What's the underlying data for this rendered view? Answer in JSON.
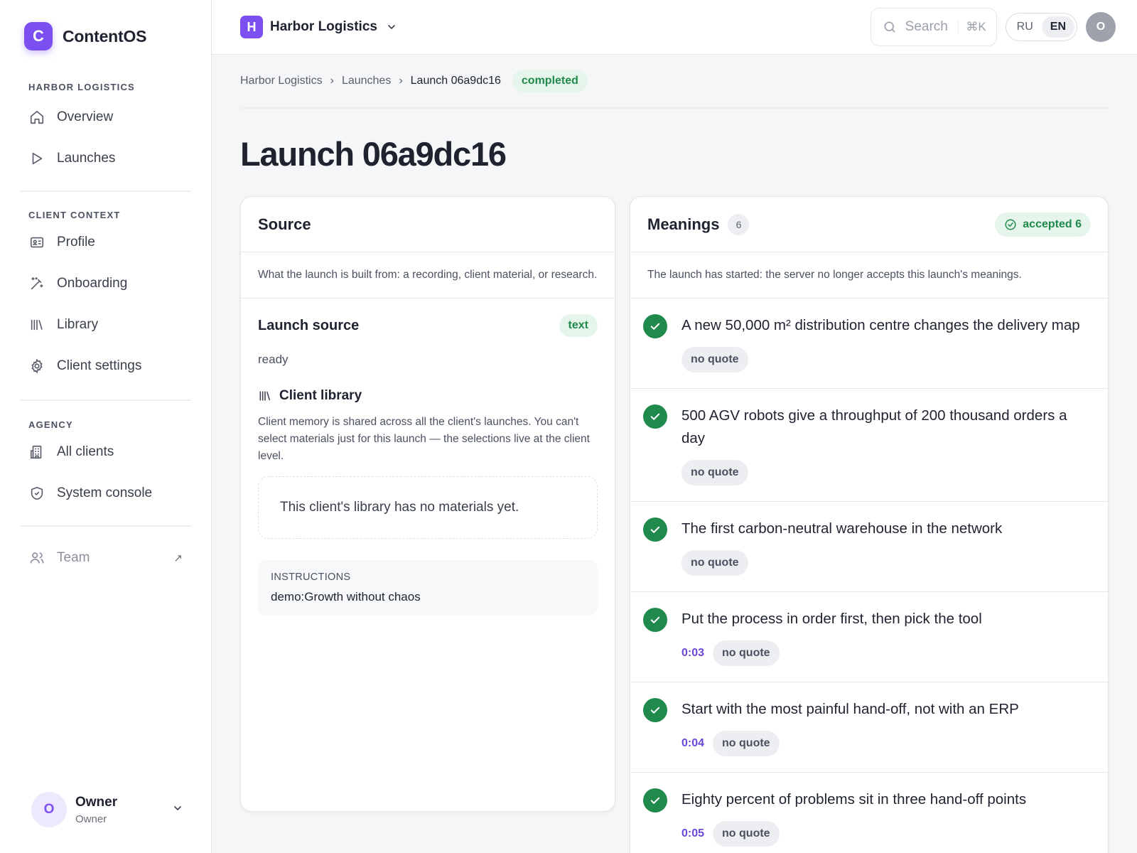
{
  "brand": {
    "logo_letter": "C",
    "name": "ContentOS",
    "accent": "#7c4ff0"
  },
  "sidebar": {
    "sections": [
      {
        "title": "HARBOR LOGISTICS",
        "items": [
          {
            "label": "Overview",
            "icon": "home-icon"
          },
          {
            "label": "Launches",
            "icon": "play-icon"
          }
        ]
      },
      {
        "title": "CLIENT CONTEXT",
        "items": [
          {
            "label": "Profile",
            "icon": "id-card-icon"
          },
          {
            "label": "Onboarding",
            "icon": "magic-wand-icon"
          },
          {
            "label": "Library",
            "icon": "library-icon"
          },
          {
            "label": "Client settings",
            "icon": "gear-icon"
          }
        ]
      },
      {
        "title": "AGENCY",
        "items": [
          {
            "label": "All clients",
            "icon": "building-icon"
          },
          {
            "label": "System console",
            "icon": "shield-icon"
          }
        ]
      }
    ],
    "team": {
      "label": "Team",
      "icon": "users-icon",
      "ext": "↗"
    },
    "user": {
      "initial": "O",
      "name": "Owner",
      "role": "Owner"
    }
  },
  "topbar": {
    "workspace": {
      "initial": "H",
      "name": "Harbor Logistics"
    },
    "search": {
      "placeholder": "Search",
      "shortcut": "⌘K"
    },
    "languages": [
      "RU",
      "EN"
    ],
    "active_language": "EN",
    "avatar_initial": "O"
  },
  "breadcrumb": {
    "items": [
      "Harbor Logistics",
      "Launches",
      "Launch 06a9dc16"
    ],
    "separator": "›",
    "status": "completed"
  },
  "page": {
    "title": "Launch 06a9dc16"
  },
  "source": {
    "title": "Source",
    "description": "What the launch is built from: a recording, client material, or research.",
    "launch_source_title": "Launch source",
    "launch_source_tag": "text",
    "status": "ready",
    "library_title": "Client library",
    "library_description": "Client memory is shared across all the client's launches. You can't select materials just for this launch — the selections live at the client level.",
    "library_empty": "This client's library has no materials yet.",
    "instructions_label": "INSTRUCTIONS",
    "instructions_value": "demo:Growth without chaos"
  },
  "meanings": {
    "title": "Meanings",
    "count": "6",
    "accepted_label": "accepted 6",
    "notice": "The launch has started: the server no longer accepts this launch's meanings.",
    "items": [
      {
        "text": "A new 50,000 m² distribution centre changes the delivery map",
        "time": "",
        "quote": "no quote"
      },
      {
        "text": "500 AGV robots give a throughput of 200 thousand orders a day",
        "time": "",
        "quote": "no quote"
      },
      {
        "text": "The first carbon-neutral warehouse in the network",
        "time": "",
        "quote": "no quote"
      },
      {
        "text": "Put the process in order first, then pick the tool",
        "time": "0:03",
        "quote": "no quote"
      },
      {
        "text": "Start with the most painful hand-off, not with an ERP",
        "time": "0:04",
        "quote": "no quote"
      },
      {
        "text": "Eighty percent of problems sit in three hand-off points",
        "time": "0:05",
        "quote": "no quote"
      }
    ]
  },
  "colors": {
    "accent": "#7c4ff0",
    "success": "#1f8a4c",
    "success_bg": "#e6f5ec",
    "time": "#6a45d8"
  }
}
